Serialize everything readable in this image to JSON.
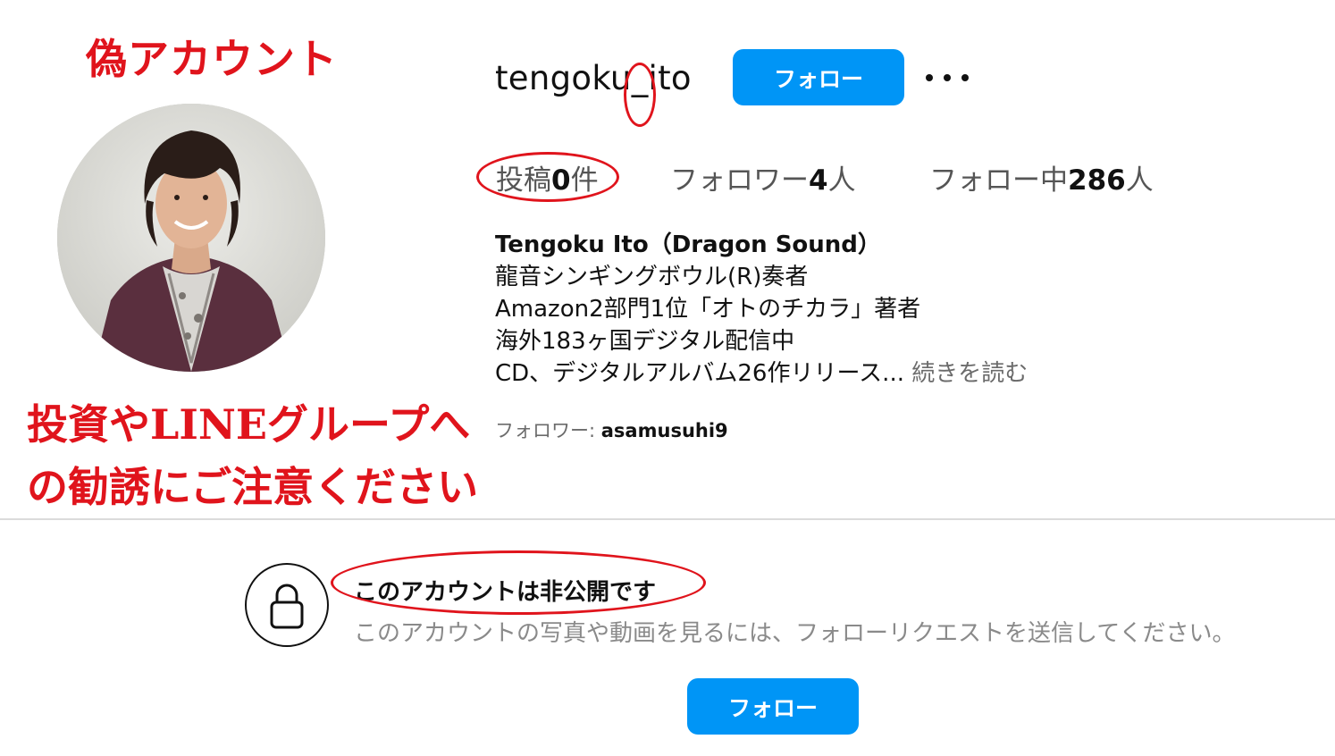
{
  "annotations": {
    "warning_title": "偽アカウント",
    "warning_message_line1": "投資やLINEグループへ",
    "warning_message_line2": "の勧誘にご注意ください",
    "color": "#e0141c"
  },
  "profile": {
    "username": "tengoku_ito",
    "username_part1": "tengoku",
    "username_part2": "_",
    "username_part3": "ito",
    "follow_label": "フォロー",
    "more_icon": "more-horizontal-icon",
    "avatar_icon": "profile-photo"
  },
  "stats": {
    "posts_label": "投稿",
    "posts_count": "0",
    "posts_unit": "件",
    "followers_label": "フォロワー",
    "followers_count": "4",
    "followers_unit": "人",
    "following_label": "フォロー中",
    "following_count": "286",
    "following_unit": "人"
  },
  "bio": {
    "name": "Tengoku Ito（Dragon Sound）",
    "line1": "龍音シンギングボウル(R)奏者",
    "line2": "Amazon2部門1位「オトのチカラ」著者",
    "line3": "海外183ヶ国デジタル配信中",
    "line4": "CD、デジタルアルバム26作リリース...",
    "read_more": "続きを読む",
    "followed_by_label": "フォロワー: ",
    "followed_by_user": "asamusuhi9"
  },
  "private": {
    "title": "このアカウントは非公開です",
    "description": "このアカウントの写真や動画を見るには、フォローリクエストを送信してください。",
    "follow_label": "フォロー",
    "lock_icon": "lock-icon"
  },
  "colors": {
    "accent": "#0095f6",
    "annotation": "#e0141c",
    "divider": "#dbdbdb"
  }
}
